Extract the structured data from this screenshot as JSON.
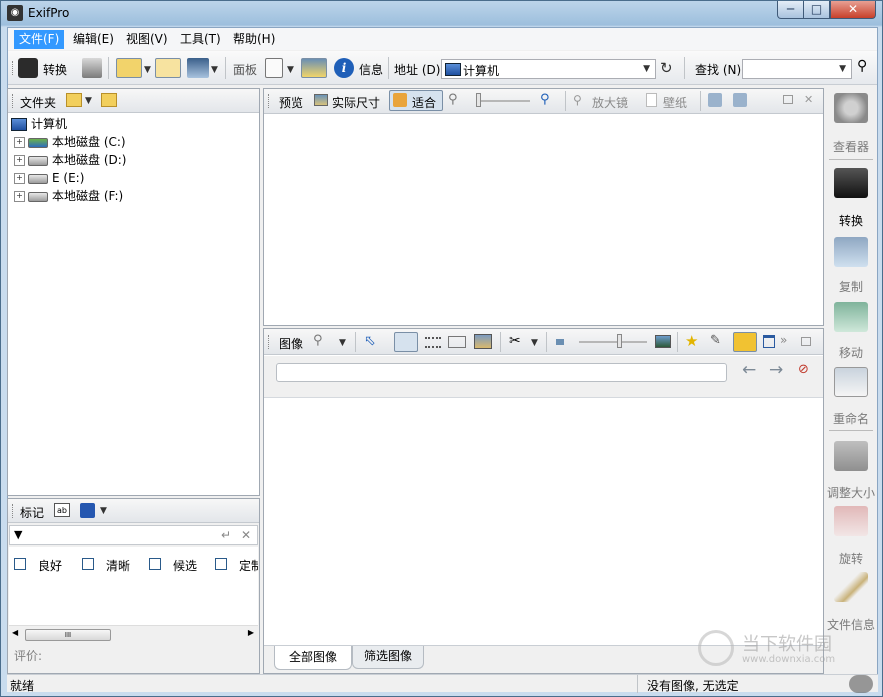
{
  "window": {
    "title": "ExifPro",
    "min_glyph": "─",
    "max_glyph": "□",
    "close_glyph": "✕"
  },
  "menu": {
    "items": [
      "文件(F)",
      "编辑(E)",
      "视图(V)",
      "工具(T)",
      "帮助(H)"
    ]
  },
  "toolbar": {
    "convert_label": "转换",
    "panel_label": "面板",
    "info_label": "信息",
    "address_label": "地址 (D)",
    "address_value": "计算机",
    "find_label": "查找 (N)",
    "find_value": ""
  },
  "folder_pane": {
    "title": "文件夹",
    "tree": {
      "root": "计算机",
      "children": [
        "本地磁盘 (C:)",
        "本地磁盘 (D:)",
        "E (E:)",
        "本地磁盘 (F:)"
      ]
    }
  },
  "tags_pane": {
    "title": "标记",
    "filter_value": "",
    "tags": [
      "良好",
      "清晰",
      "候选",
      "定制"
    ],
    "rating_label": "评价:",
    "scroll_grip": "III"
  },
  "preview_pane": {
    "preview_label": "预览",
    "actual_size_label": "实际尺寸",
    "fit_label": "适合",
    "magnifier_label": "放大镜",
    "wallpaper_label": "壁纸"
  },
  "image_pane": {
    "title": "图像",
    "search_value": "",
    "tabs": [
      "全部图像",
      "筛选图像"
    ]
  },
  "sidebar": {
    "items": [
      "查看器",
      "转换",
      "复制",
      "移动",
      "重命名",
      "调整大小",
      "旋转",
      "文件信息"
    ]
  },
  "statusbar": {
    "left": "就绪",
    "right": "没有图像, 无选定"
  },
  "watermark": {
    "text": "当下软件园",
    "url": "www.downxia.com"
  },
  "colors": {
    "menu_active": "#3399ff",
    "accent": "#1e4fa0"
  }
}
